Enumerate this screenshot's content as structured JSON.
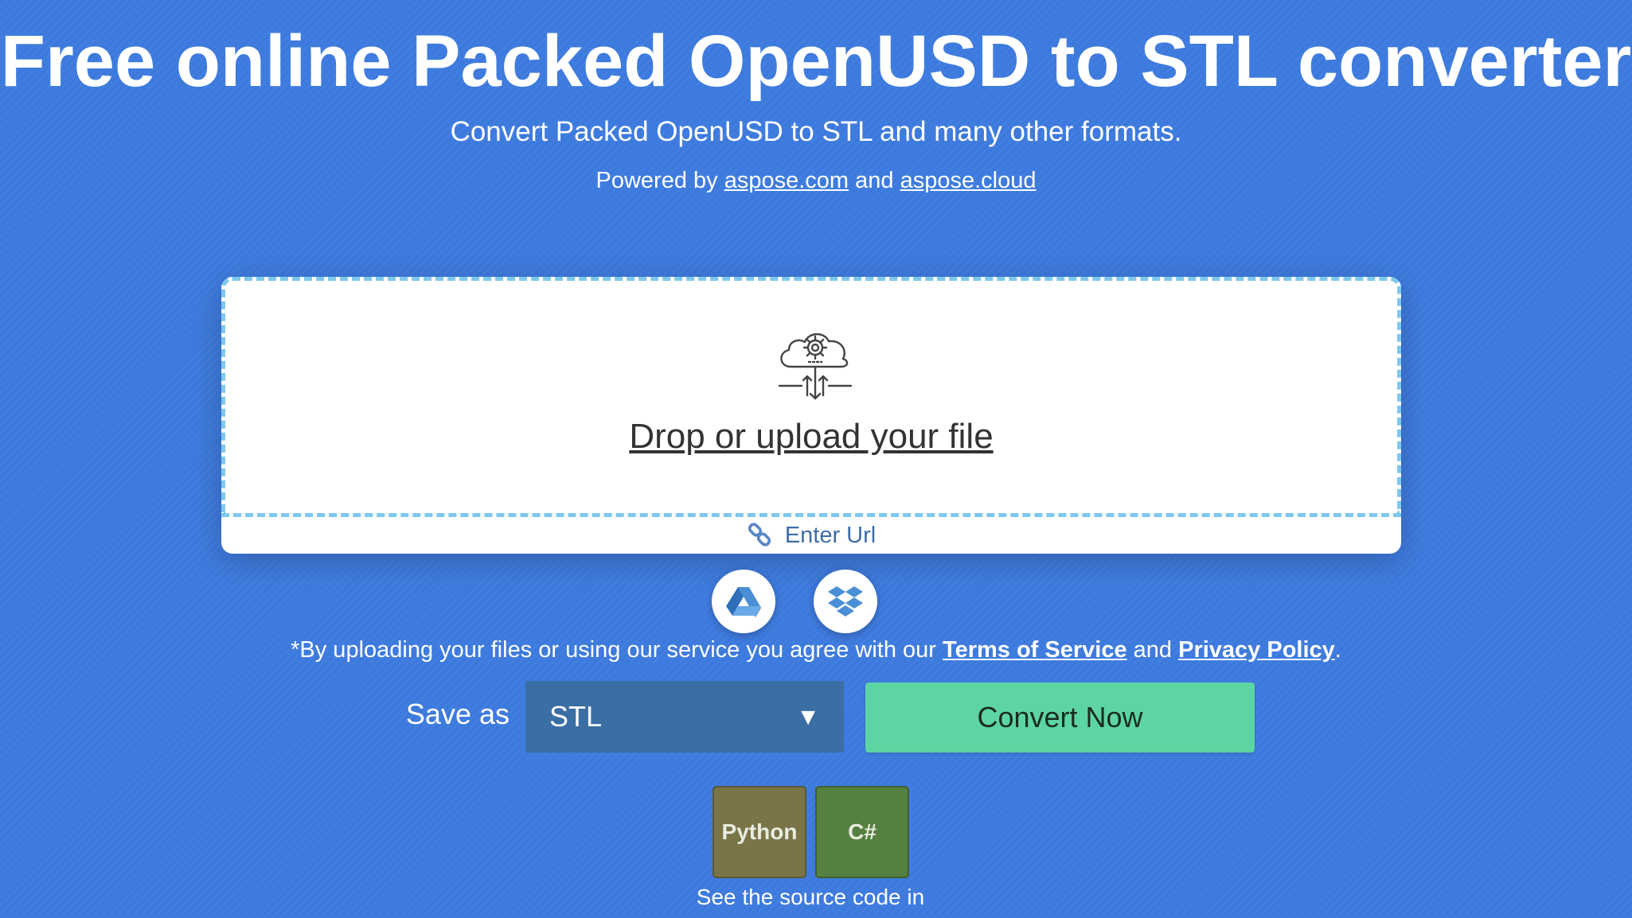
{
  "header": {
    "title": "Free online Packed OpenUSD to STL converter",
    "subtitle": "Convert Packed OpenUSD to STL and many other formats.",
    "powered_prefix": "Powered by",
    "powered_link_1": "aspose.com",
    "powered_and": "and",
    "powered_link_2": "aspose.cloud"
  },
  "upload": {
    "icon": "cloud-gear-upload-icon",
    "drop_label": "Drop or upload your file",
    "url_icon": "link-icon",
    "enter_url_label": "Enter Url"
  },
  "cloud_sources": [
    {
      "icon": "google-drive-icon"
    },
    {
      "icon": "dropbox-icon"
    }
  ],
  "terms": {
    "prefix": "*By uploading your files or using our service you agree with our",
    "terms_link": "Terms of Service",
    "and": "and",
    "privacy_link": "Privacy Policy",
    "suffix": "."
  },
  "convert": {
    "save_as_label": "Save as",
    "selected_format": "STL",
    "dropdown_arrow": "▼",
    "convert_button": "Convert Now"
  },
  "source_code": {
    "languages": [
      "Python",
      "C#"
    ],
    "caption": "See the source code in"
  },
  "colors": {
    "background": "#3d7ade",
    "select_bg": "#3a6ea5",
    "convert_button": "#5dd5a3",
    "dropzone_border": "#7ec8ee",
    "python_tile": "#7a7549",
    "csharp_tile": "#55803f"
  }
}
